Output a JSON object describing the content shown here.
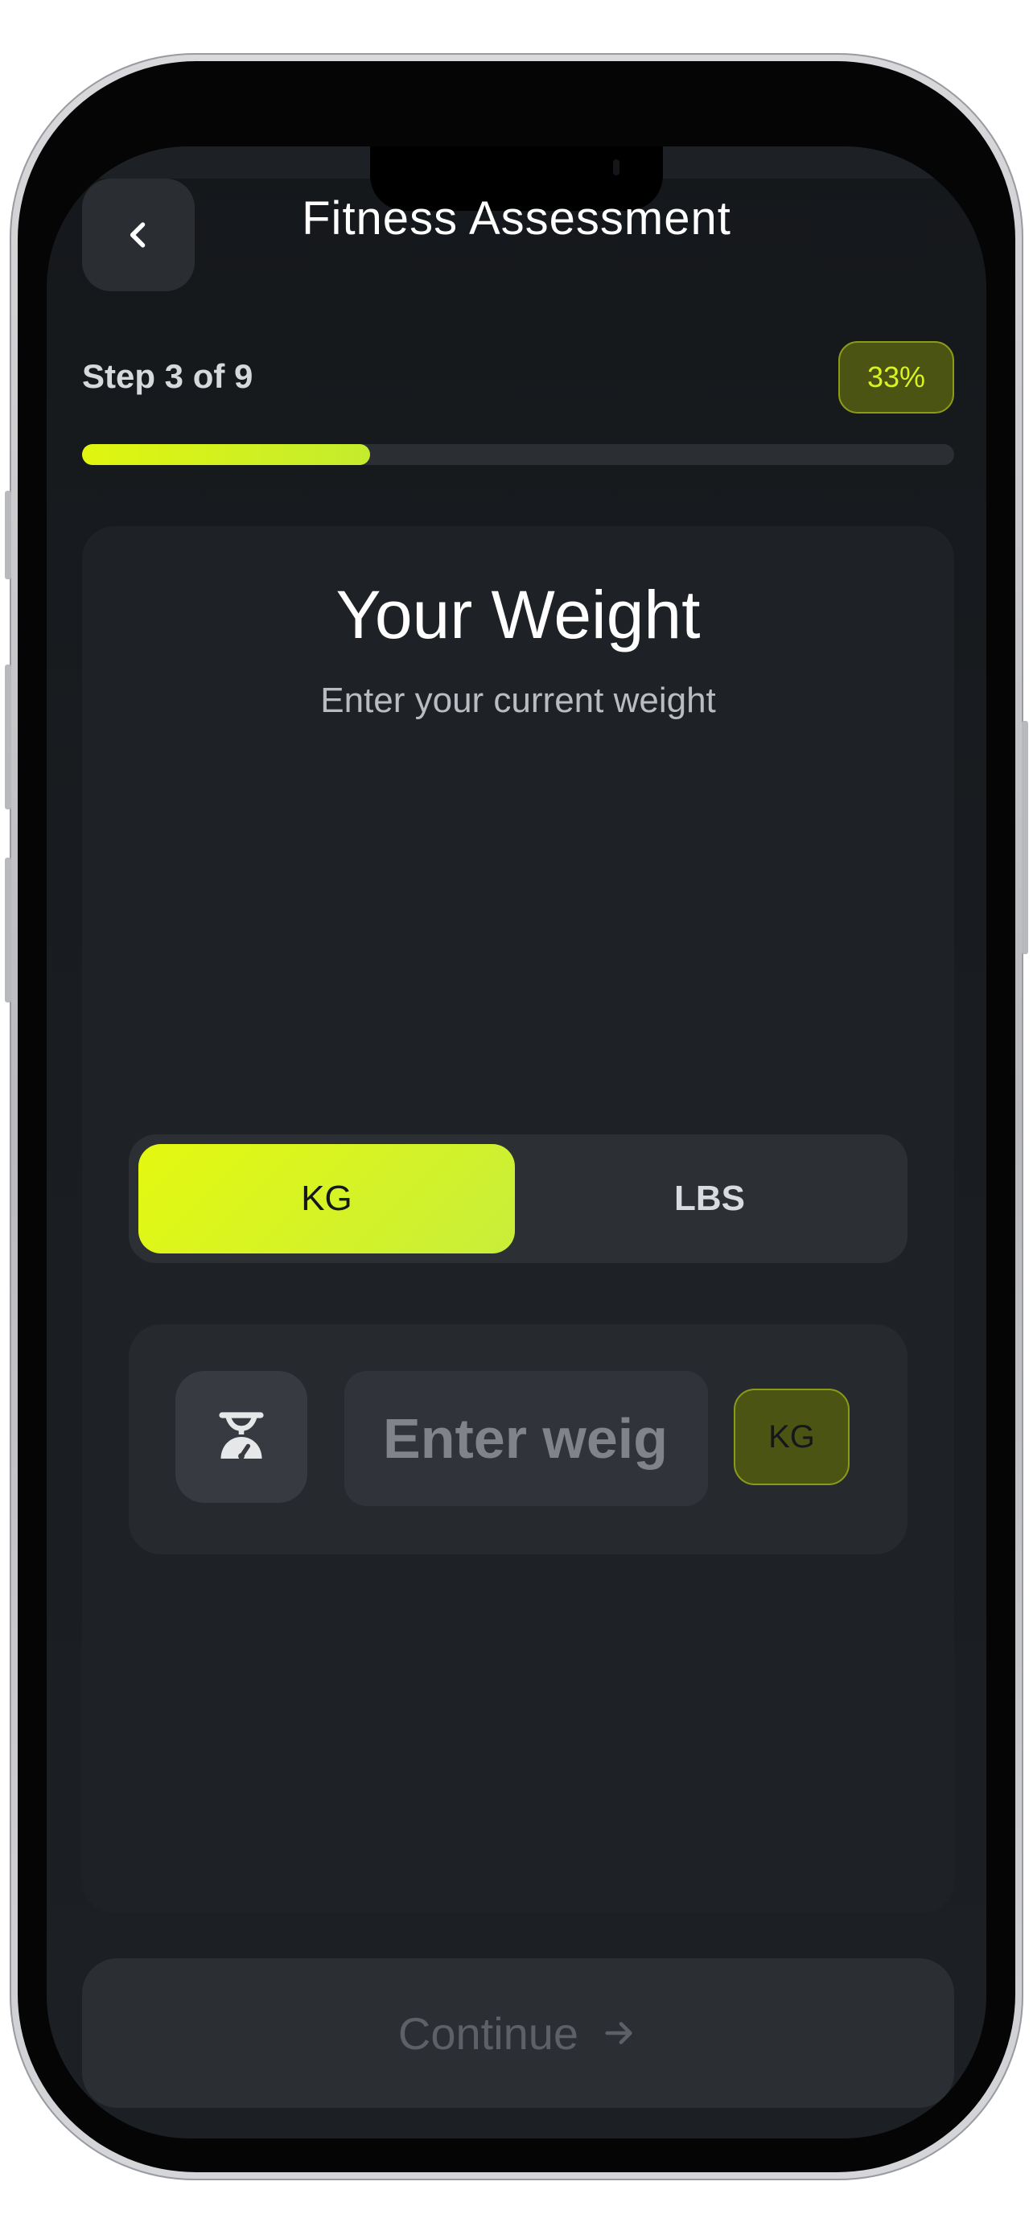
{
  "header": {
    "title": "Fitness Assessment",
    "back_icon": "chevron-left-icon"
  },
  "progress": {
    "step_label": "Step 3 of 9",
    "percent_label": "33%",
    "fraction": 0.33
  },
  "card": {
    "title": "Your Weight",
    "subtitle": "Enter your current weight"
  },
  "unit_toggle": {
    "options": [
      "KG",
      "LBS"
    ],
    "selected": "KG"
  },
  "weight_input": {
    "icon": "weight-scale-icon",
    "placeholder": "Enter weight",
    "value": "",
    "unit_label": "KG"
  },
  "footer": {
    "continue_label": "Continue",
    "continue_icon": "arrow-right-icon",
    "enabled": false
  },
  "colors": {
    "accent": "#e0f50f",
    "background": "#191d21",
    "card": "#1e2226",
    "badge_bg": "#4c5414"
  }
}
